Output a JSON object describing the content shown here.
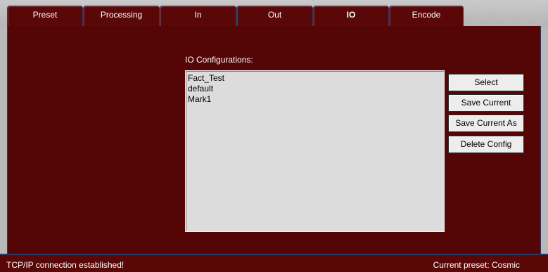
{
  "tabs": [
    {
      "label": "Preset",
      "active": false
    },
    {
      "label": "Processing",
      "active": false
    },
    {
      "label": "In",
      "active": false
    },
    {
      "label": "Out",
      "active": false
    },
    {
      "label": "IO",
      "active": true
    },
    {
      "label": "Encode",
      "active": false
    }
  ],
  "io": {
    "configurations_label": "IO Configurations:",
    "configurations": [
      "Fact_Test",
      "default",
      "Mark1"
    ],
    "buttons": {
      "select": "Select",
      "save_current": "Save Current",
      "save_current_as": "Save Current As",
      "delete_config": "Delete Config"
    }
  },
  "status": {
    "connection": "TCP/IP connection established!",
    "current_preset": "Current preset: Cosmic"
  },
  "colors": {
    "panel_bg": "#540606",
    "tab_border": "#2a3a66",
    "list_bg": "#dcdcdc"
  }
}
